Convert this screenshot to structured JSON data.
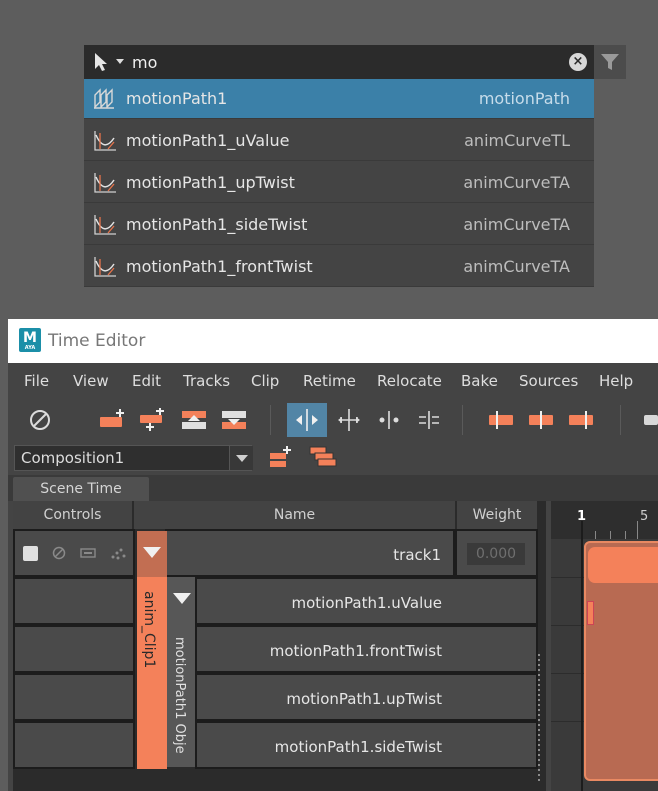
{
  "search": {
    "query": "mo",
    "clear_symbol": "×",
    "results": [
      {
        "name": "motionPath1",
        "type": "motionPath",
        "icon": "motion-path-icon",
        "selected": true
      },
      {
        "name": "motionPath1_uValue",
        "type": "animCurveTL",
        "icon": "anim-curve-icon"
      },
      {
        "name": "motionPath1_upTwist",
        "type": "animCurveTA",
        "icon": "anim-curve-icon"
      },
      {
        "name": "motionPath1_sideTwist",
        "type": "animCurveTA",
        "icon": "anim-curve-icon"
      },
      {
        "name": "motionPath1_frontTwist",
        "type": "animCurveTA",
        "icon": "anim-curve-icon"
      }
    ]
  },
  "window": {
    "title": "Time Editor",
    "logo_letter": "M",
    "logo_sub": "AYA"
  },
  "menu": [
    "File",
    "View",
    "Edit",
    "Tracks",
    "Clip",
    "Retime",
    "Relocate",
    "Bake",
    "Sources",
    "Help"
  ],
  "composition": {
    "selected": "Composition1"
  },
  "tabs": {
    "scene_time": "Scene Time"
  },
  "columns": {
    "controls": "Controls",
    "name": "Name",
    "weight": "Weight"
  },
  "track": {
    "name": "track1",
    "weight": "0.000"
  },
  "clip": {
    "label": "anim_Clip1",
    "sub_label": "motionPath1 Obje"
  },
  "attributes": [
    "motionPath1.uValue",
    "motionPath1.frontTwist",
    "motionPath1.upTwist",
    "motionPath1.sideTwist"
  ],
  "timeline": {
    "current_frame": "1",
    "tick_5": "5"
  },
  "colors": {
    "clip_orange": "#f4815a",
    "selection_blue": "#3b80a8",
    "active_tool": "#5285a6"
  }
}
